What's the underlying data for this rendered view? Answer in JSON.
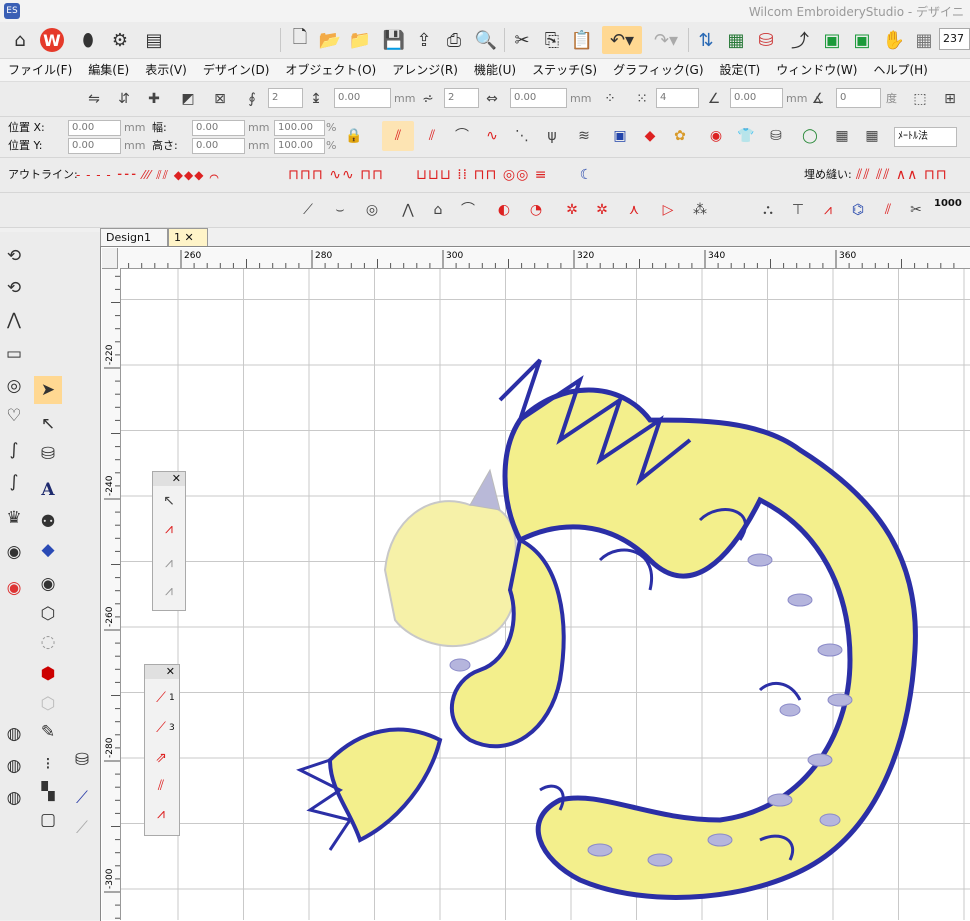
{
  "window": {
    "title": "Wilcom EmbroideryStudio - デザイニ"
  },
  "toolbar": {
    "zoom_value": "237"
  },
  "menu": [
    "ファイル(F)",
    "編集(E)",
    "表示(V)",
    "デザイン(D)",
    "オブジェクト(O)",
    "アレンジ(R)",
    "機能(U)",
    "ステッチ(S)",
    "グラフィック(G)",
    "設定(T)",
    "ウィンドウ(W)",
    "ヘルプ(H)"
  ],
  "transform_bar": {
    "spin1": "2",
    "spin2": "0.00",
    "unit_mm": "mm",
    "spin3": "2",
    "spin4": "0.00",
    "spin5": "4",
    "spin6": "0.00",
    "spin7": "0",
    "unit_deg": "度"
  },
  "position_bar": {
    "pos_x_label": "位置 X:",
    "pos_y_label": "位置 Y:",
    "pos_x": "0.00",
    "pos_y": "0.00",
    "width_label": "幅:",
    "height_label": "高さ:",
    "width": "0.00",
    "height": "0.00",
    "scale_w": "100.00",
    "scale_h": "100.00",
    "unit_mm": "mm",
    "unit_pct": "%",
    "method_select": "ﾒｰﾄﾙ法"
  },
  "outline_bar": {
    "outline_label": "アウトライン:",
    "fill_label": "埋め縫い:",
    "count_1000": "1000"
  },
  "tabs": [
    {
      "label": "Design1"
    },
    {
      "label": "1"
    }
  ],
  "rulers": {
    "h_labels": [
      "260",
      "280",
      "300",
      "320",
      "340",
      "360"
    ],
    "v_labels": [
      "-220",
      "-240",
      "-260",
      "-280",
      "-300"
    ]
  },
  "flyout_small": {
    "markers": [
      "1",
      "3"
    ]
  },
  "colors": {
    "accent_orange": "#ffd892",
    "stitch_blue": "#2b2fa6",
    "stitch_yellow": "#f3ef8c"
  }
}
